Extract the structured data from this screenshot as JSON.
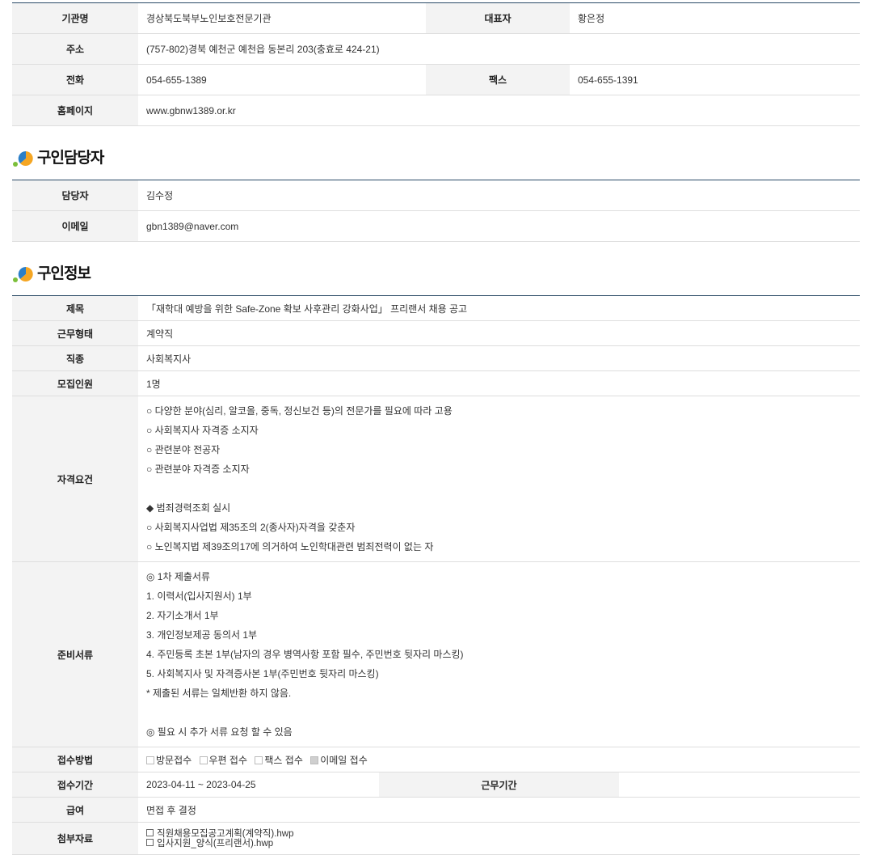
{
  "agency": {
    "name_label": "기관명",
    "name_value": "경상북도북부노인보호전문기관",
    "rep_label": "대표자",
    "rep_value": "황은정",
    "address_label": "주소",
    "address_value": "(757-802)경북 예천군 예천읍 동본리 203(충효로 424-21)",
    "phone_label": "전화",
    "phone_value": "054-655-1389",
    "fax_label": "팩스",
    "fax_value": "054-655-1391",
    "homepage_label": "홈페이지",
    "homepage_value": "www.gbnw1389.or.kr"
  },
  "contact_section": {
    "title": "구인담당자",
    "manager_label": "담당자",
    "manager_value": "김수정",
    "email_label": "이메일",
    "email_value": "gbn1389@naver.com"
  },
  "job_section": {
    "title": "구인정보",
    "title_label": "제목",
    "title_value": "「재학대 예방을 위한 Safe-Zone 확보 사후관리 강화사업」 프리랜서 채용 공고",
    "type_label": "근무형태",
    "type_value": "계약직",
    "occupation_label": "직종",
    "occupation_value": "사회복지사",
    "headcount_label": "모집인원",
    "headcount_value": "1명",
    "qualification_label": "자격요건",
    "qualification_lines": [
      "○ 다양한 분야(심리, 알코올, 중독, 정신보건 등)의 전문가를 필요에 따라 고용",
      "○ 사회복지사 자격증 소지자",
      "○ 관련분야 전공자",
      "○ 관련분야 자격증 소지자",
      "",
      "◆ 범죄경력조회 실시",
      "○ 사회복지사업법 제35조의 2(종사자)자격을 갖춘자",
      "○ 노인복지법 제39조의17에 의거하여 노인학대관련 범죄전력이 없는 자"
    ],
    "documents_label": "준비서류",
    "documents_lines": [
      "◎ 1차 제출서류",
      " 1. 이력서(입사지원서) 1부",
      " 2. 자기소개서 1부",
      " 3. 개인정보제공 동의서 1부",
      " 4. 주민등록 초본 1부(남자의 경우 병역사항 포함 필수, 주민번호 뒷자리 마스킹)",
      " 5. 사회복지사 및 자격증사본 1부(주민번호 뒷자리 마스킹)",
      " * 제출된 서류는 일체반환 하지 않음.",
      "",
      "◎ 필요 시 추가 서류 요청 할 수 있음"
    ],
    "method_label": "접수방법",
    "methods": [
      {
        "label": "방문접수",
        "checked": false
      },
      {
        "label": "우편 접수",
        "checked": false
      },
      {
        "label": "팩스 접수",
        "checked": false
      },
      {
        "label": "이메일 접수",
        "checked": true
      }
    ],
    "period_label": "접수기간",
    "period_value": "2023-04-11 ~ 2023-04-25",
    "work_period_label": "근무기간",
    "work_period_value": "",
    "salary_label": "급여",
    "salary_value": "면접 후 결정",
    "attachment_label": "첨부자료",
    "attachments": [
      "직원채용모집공고계획(계약직).hwp",
      "입사지원_양식(프리랜서).hwp"
    ]
  },
  "colors": {
    "header_bg": "#f3f3f3",
    "top_border": "#2a4a66",
    "icon_blue": "#2b7fc8",
    "icon_orange": "#f5a623",
    "icon_green": "#7bbf3a"
  },
  "icons": {
    "section_bullet": "section-bullet-icon"
  }
}
